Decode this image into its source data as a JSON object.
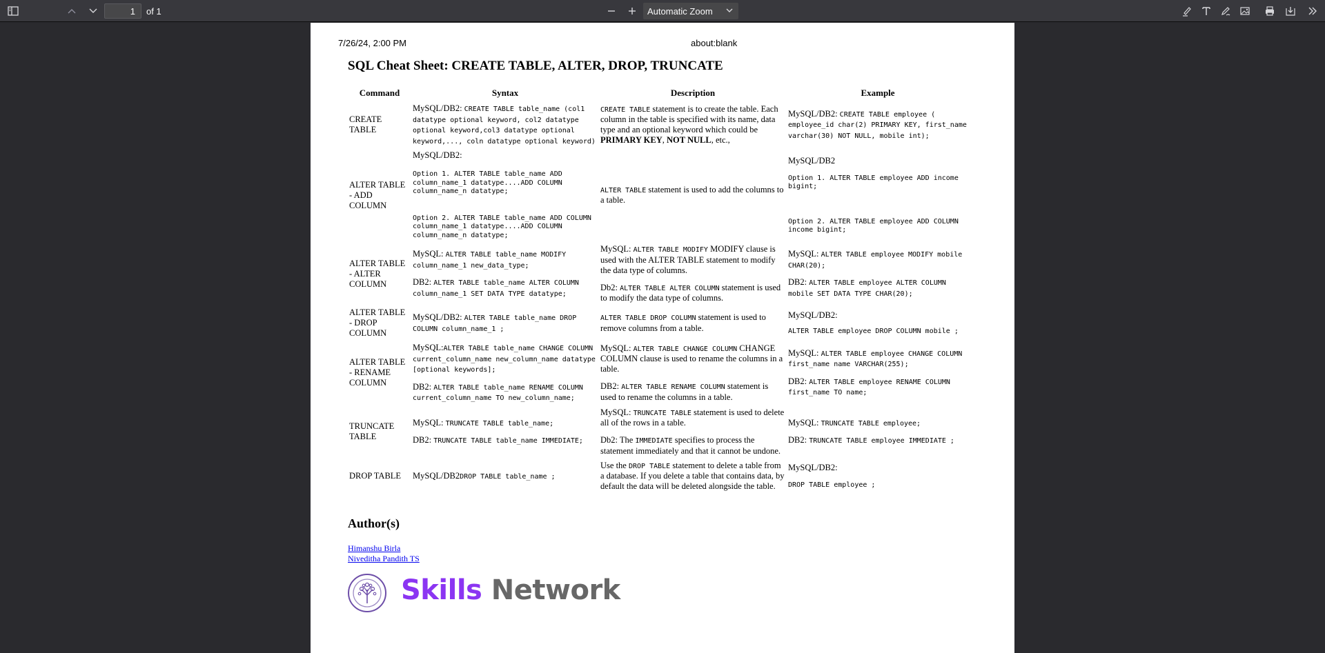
{
  "toolbar": {
    "page_number": "1",
    "page_count": "of 1",
    "zoom": "Automatic Zoom",
    "icons": [
      "sidebar-toggle-icon",
      "page-up-icon",
      "page-down-icon",
      "zoom-out-icon",
      "zoom-in-icon",
      "chevron-down-icon",
      "highlight-icon",
      "text-icon",
      "draw-icon",
      "image-icon",
      "print-icon",
      "save-icon",
      "more-tools-icon"
    ]
  },
  "page": {
    "header_date": "7/26/24, 2:00 PM",
    "header_url": "about:blank",
    "title": "SQL Cheat Sheet: CREATE TABLE, ALTER, DROP, TRUNCATE",
    "columns": [
      "Command",
      "Syntax",
      "Description",
      "Example"
    ],
    "rows": {
      "create": {
        "cmd": "CREATE TABLE",
        "syn_prefix": "MySQL/DB2: ",
        "syn_code": "CREATE TABLE table_name (col1 datatype optional keyword, col2 datatype optional keyword,col3 datatype optional keyword,..., coln datatype optional keyword)",
        "desc_code": "CREATE TABLE",
        "desc_text": " statement is to create the table. Each column in the table is specified with its name, data type and an optional keyword which could be ",
        "desc_bold1": "PRIMARY KEY",
        "desc_sep": ", ",
        "desc_bold2": "NOT NULL",
        "desc_end": ", etc.,",
        "ex_prefix": "MySQL/DB2: ",
        "ex_code": "CREATE TABLE employee ( employee_id char(2) PRIMARY KEY, first_name varchar(30) NOT NULL, mobile int);"
      },
      "add": {
        "cmd": "ALTER TABLE - ADD COLUMN",
        "syn_label": "MySQL/DB2:",
        "syn_opt1": "Option 1. ALTER TABLE table_name ADD column_name_1 datatype....ADD COLUMN column_name_n datatype;",
        "syn_opt2": "Option 2. ALTER TABLE table_name ADD COLUMN column_name_1 datatype....ADD COLUMN column_name_n datatype;",
        "desc_code": "ALTER TABLE",
        "desc_text": " statement is used to add the columns to a table.",
        "ex_label": "MySQL/DB2",
        "ex_opt1": "Option 1. ALTER TABLE employee ADD income bigint;",
        "ex_opt2": "Option 2. ALTER TABLE employee ADD COLUMN income bigint;"
      },
      "alter": {
        "cmd": "ALTER TABLE - ALTER COLUMN",
        "syn_mysql_prefix": "MySQL: ",
        "syn_mysql_code": "ALTER TABLE table_name MODIFY column_name_1 new_data_type;",
        "syn_db2_prefix": "DB2: ",
        "syn_db2_code": "ALTER TABLE table_name ALTER COLUMN column_name_1 SET DATA TYPE datatype;",
        "desc_mysql_prefix": "MySQL: ",
        "desc_mysql_code": "ALTER TABLE MODIFY",
        "desc_mysql_text": " MODIFY clause is used with the ALTER TABLE statement to modify the data type of columns.",
        "desc_db2_prefix": "Db2: ",
        "desc_db2_code": "ALTER TABLE ALTER COLUMN",
        "desc_db2_text": " statement is used to modify the data type of columns.",
        "ex_mysql_prefix": "MySQL: ",
        "ex_mysql_code": "ALTER TABLE employee MODIFY mobile CHAR(20);",
        "ex_db2_prefix": "DB2: ",
        "ex_db2_code": "ALTER TABLE employee ALTER COLUMN mobile SET DATA TYPE CHAR(20);"
      },
      "drop_col": {
        "cmd": "ALTER TABLE - DROP COLUMN",
        "syn_prefix": "MySQL/DB2: ",
        "syn_code": "ALTER TABLE table_name DROP COLUMN column_name_1 ;",
        "desc_code": "ALTER TABLE DROP COLUMN",
        "desc_text": " statement is used to remove columns from a table.",
        "ex_label": "MySQL/DB2:",
        "ex_code": "ALTER TABLE employee DROP COLUMN mobile ;"
      },
      "rename": {
        "cmd": "ALTER TABLE - RENAME COLUMN",
        "syn_mysql_prefix": "MySQL:",
        "syn_mysql_code": "ALTER TABLE table_name CHANGE COLUMN current_column_name new_column_name datatype [optional keywords];",
        "syn_db2_prefix": "DB2: ",
        "syn_db2_code": "ALTER TABLE table_name RENAME COLUMN current_column_name TO new_column_name;",
        "desc_mysql_prefix": "MySQL: ",
        "desc_mysql_code": "ALTER TABLE CHANGE COLUMN",
        "desc_mysql_text": " CHANGE COLUMN clause is used to rename the columns in a table.",
        "desc_db2_prefix": "DB2: ",
        "desc_db2_code": "ALTER TABLE RENAME COLUMN",
        "desc_db2_text": " statement is used to rename the columns in a table.",
        "ex_mysql_prefix": "MySQL: ",
        "ex_mysql_code": "ALTER TABLE employee CHANGE COLUMN first_name name VARCHAR(255);",
        "ex_db2_prefix": "DB2: ",
        "ex_db2_code": "ALTER TABLE employee RENAME COLUMN first_name TO name;"
      },
      "truncate": {
        "cmd": "TRUNCATE TABLE",
        "syn_mysql_prefix": "MySQL: ",
        "syn_mysql_code": "TRUNCATE TABLE table_name;",
        "syn_db2_prefix": "DB2: ",
        "syn_db2_code": "TRUNCATE TABLE table_name IMMEDIATE;",
        "desc_mysql_prefix": "MySQL: ",
        "desc_mysql_code": "TRUNCATE TABLE",
        "desc_mysql_text": " statement is used to delete all of the rows in a table.",
        "desc_db2_prefix": "Db2: The ",
        "desc_db2_code": "IMMEDIATE",
        "desc_db2_text": " specifies to process the statement immediately and that it cannot be undone.",
        "ex_mysql_prefix": "MySQL: ",
        "ex_mysql_code": "TRUNCATE TABLE employee;",
        "ex_db2_prefix": "DB2: ",
        "ex_db2_code": "TRUNCATE TABLE employee IMMEDIATE ;"
      },
      "drop_table": {
        "cmd": "DROP TABLE",
        "syn_prefix": "MySQL/DB2",
        "syn_code": "DROP TABLE table_name ;",
        "desc_prefix": "Use the ",
        "desc_code": "DROP TABLE",
        "desc_text": " statement to delete a table from a database. If you delete a table that contains data, by default the data will be deleted alongside the table.",
        "ex_label": "MySQL/DB2:",
        "ex_code": "DROP TABLE employee ;"
      }
    },
    "authors_heading": "Author(s)",
    "authors": [
      "Himanshu Birla",
      "Niveditha Pandith TS"
    ],
    "brand_part1": "Skills",
    "brand_part2": " Network",
    "colors": {
      "brand_purple": "#8b35f2",
      "brand_gray": "#676767",
      "link": "#0000ee",
      "toolbar_bg": "#38383d",
      "viewer_bg": "#2a2a2e"
    }
  }
}
